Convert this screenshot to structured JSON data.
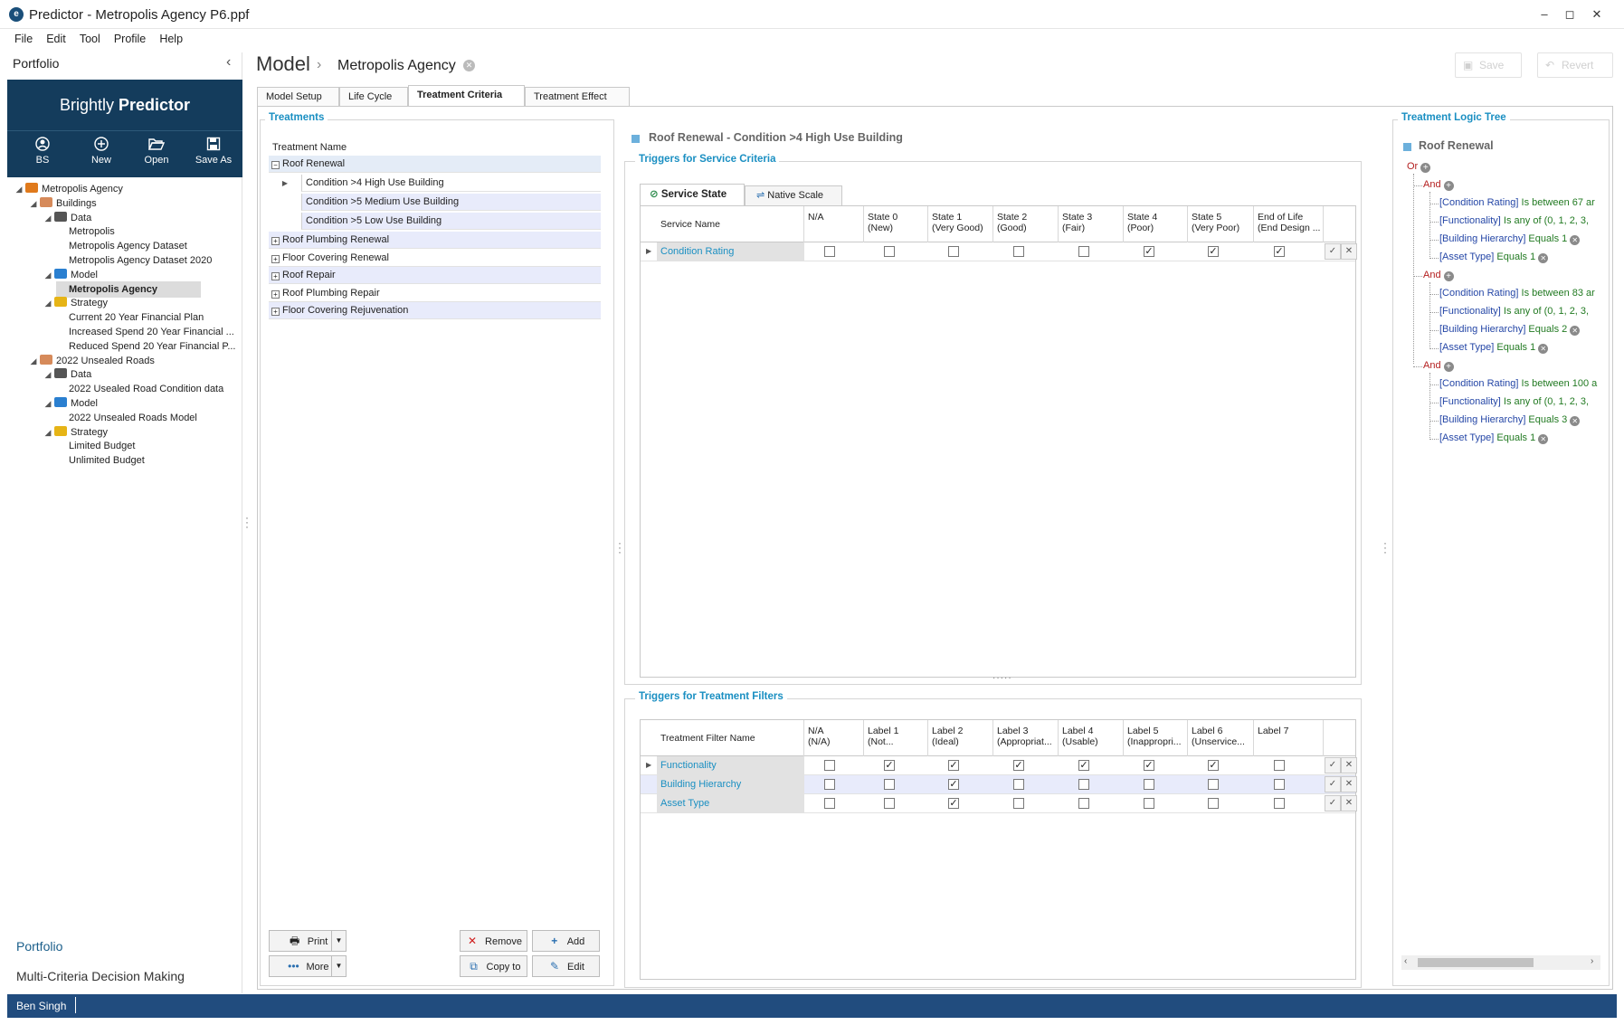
{
  "window": {
    "title": "Predictor - Metropolis Agency P6.ppf",
    "minimize": "–",
    "maximize": "◻",
    "close": "✕"
  },
  "menu": [
    "File",
    "Edit",
    "Tool",
    "Profile",
    "Help"
  ],
  "left_panel": {
    "title": "Portfolio",
    "brand_light": "Brightly ",
    "brand_bold": "Predictor",
    "toolbar": [
      {
        "label": "BS",
        "icon": "user-icon"
      },
      {
        "label": "New",
        "icon": "plus-circle-icon"
      },
      {
        "label": "Open",
        "icon": "folder-open-icon"
      },
      {
        "label": "Save As",
        "icon": "save-icon"
      }
    ],
    "tree": [
      {
        "label": "Metropolis Agency",
        "icon": "portfolio-icon",
        "level": 0,
        "expander": true,
        "selected": false
      },
      {
        "label": "Buildings",
        "icon": "asset-group-icon",
        "level": 1,
        "expander": true,
        "selected": false
      },
      {
        "label": "Data",
        "icon": "database-icon",
        "level": 2,
        "expander": true,
        "selected": false
      },
      {
        "label": "Metropolis",
        "icon": "",
        "level": 3,
        "expander": false,
        "selected": false
      },
      {
        "label": "Metropolis Agency Dataset",
        "icon": "",
        "level": 3,
        "expander": false,
        "selected": false
      },
      {
        "label": "Metropolis Agency Dataset 2020",
        "icon": "",
        "level": 3,
        "expander": false,
        "selected": false
      },
      {
        "label": "Model",
        "icon": "chart-icon",
        "level": 2,
        "expander": true,
        "selected": false
      },
      {
        "label": "Metropolis Agency",
        "icon": "",
        "level": 3,
        "expander": false,
        "selected": true
      },
      {
        "label": "Strategy",
        "icon": "coins-icon",
        "level": 2,
        "expander": true,
        "selected": false
      },
      {
        "label": "Current 20 Year Financial Plan",
        "icon": "",
        "level": 3,
        "expander": false,
        "selected": false
      },
      {
        "label": "Increased Spend 20 Year Financial ...",
        "icon": "",
        "level": 3,
        "expander": false,
        "selected": false
      },
      {
        "label": "Reduced Spend 20 Year Financial P...",
        "icon": "",
        "level": 3,
        "expander": false,
        "selected": false
      },
      {
        "label": "2022 Unsealed Roads",
        "icon": "asset-group-icon",
        "level": 1,
        "expander": true,
        "selected": false
      },
      {
        "label": "Data",
        "icon": "database-icon",
        "level": 2,
        "expander": true,
        "selected": false
      },
      {
        "label": "2022 Usealed Road Condition data",
        "icon": "",
        "level": 3,
        "expander": false,
        "selected": false
      },
      {
        "label": "Model",
        "icon": "chart-icon",
        "level": 2,
        "expander": true,
        "selected": false
      },
      {
        "label": "2022 Unsealed Roads Model",
        "icon": "",
        "level": 3,
        "expander": false,
        "selected": false
      },
      {
        "label": "Strategy",
        "icon": "coins-icon",
        "level": 2,
        "expander": true,
        "selected": false
      },
      {
        "label": "Limited Budget",
        "icon": "",
        "level": 3,
        "expander": false,
        "selected": false
      },
      {
        "label": "Unlimited Budget",
        "icon": "",
        "level": 3,
        "expander": false,
        "selected": false
      }
    ],
    "bottom_links": [
      "Portfolio",
      "Multi-Criteria Decision Making"
    ]
  },
  "status_bar": {
    "user": "Ben Singh"
  },
  "header": {
    "section": "Model",
    "chevron": "›",
    "model_name": "Metropolis Agency",
    "save_label": "Save",
    "revert_label": "Revert"
  },
  "tabs": [
    {
      "label": "Model Setup",
      "active": false
    },
    {
      "label": "Life Cycle",
      "active": false
    },
    {
      "label": "Treatment Criteria",
      "active": true
    },
    {
      "label": "Treatment Effect",
      "active": false
    }
  ],
  "treatments": {
    "title": "Treatments",
    "column_header": "Treatment Name",
    "rows": [
      {
        "label": "Roof Renewal",
        "type": "group",
        "expanded": true
      },
      {
        "label": "Condition >4 High Use Building",
        "type": "child",
        "current": true
      },
      {
        "label": "Condition >5 Medium Use Building",
        "type": "child",
        "current": false
      },
      {
        "label": "Condition >5 Low Use Building",
        "type": "child",
        "current": false
      },
      {
        "label": "Roof Plumbing Renewal",
        "type": "group",
        "expanded": false
      },
      {
        "label": "Floor Covering Renewal",
        "type": "group",
        "expanded": false
      },
      {
        "label": "Roof Repair",
        "type": "group",
        "expanded": false
      },
      {
        "label": "Roof Plumbing Repair",
        "type": "group",
        "expanded": false
      },
      {
        "label": "Floor Covering Rejuvenation",
        "type": "group",
        "expanded": false
      }
    ],
    "buttons": {
      "print": "Print",
      "more": "More",
      "remove": "Remove",
      "copy_to": "Copy to",
      "add": "Add",
      "edit": "Edit"
    }
  },
  "criteria": {
    "selected_title": "Roof Renewal - Condition >4 High Use Building",
    "service": {
      "title": "Triggers for Service Criteria",
      "subtabs": [
        {
          "label": "Service State",
          "active": true
        },
        {
          "label": "Native Scale",
          "active": false
        }
      ],
      "columns": [
        {
          "l1": "Service Name",
          "l2": ""
        },
        {
          "l1": "N/A",
          "l2": ""
        },
        {
          "l1": "State 0",
          "l2": "(New)"
        },
        {
          "l1": "State 1",
          "l2": "(Very Good)"
        },
        {
          "l1": "State 2",
          "l2": "(Good)"
        },
        {
          "l1": "State 3",
          "l2": "(Fair)"
        },
        {
          "l1": "State 4",
          "l2": "(Poor)"
        },
        {
          "l1": "State 5",
          "l2": "(Very Poor)"
        },
        {
          "l1": "End of Life",
          "l2": "(End Design ..."
        }
      ],
      "rows": [
        {
          "name": "Condition Rating",
          "checks": [
            false,
            false,
            false,
            false,
            false,
            true,
            true,
            true
          ]
        }
      ]
    },
    "filters": {
      "title": "Triggers for Treatment Filters",
      "columns": [
        {
          "l1": "Treatment Filter Name",
          "l2": ""
        },
        {
          "l1": "N/A",
          "l2": "(N/A)"
        },
        {
          "l1": "Label 1",
          "l2": "(Not..."
        },
        {
          "l1": "Label 2",
          "l2": "(Ideal)"
        },
        {
          "l1": "Label 3",
          "l2": "(Appropriat..."
        },
        {
          "l1": "Label 4",
          "l2": "(Usable)"
        },
        {
          "l1": "Label 5",
          "l2": "(Inappropri..."
        },
        {
          "l1": "Label 6",
          "l2": "(Unservice..."
        },
        {
          "l1": "Label 7",
          "l2": ""
        }
      ],
      "rows": [
        {
          "name": "Functionality",
          "checks": [
            false,
            true,
            true,
            true,
            true,
            true,
            true,
            false
          ]
        },
        {
          "name": "Building Hierarchy",
          "checks": [
            false,
            false,
            true,
            false,
            false,
            false,
            false,
            false
          ]
        },
        {
          "name": "Asset Type",
          "checks": [
            false,
            false,
            true,
            false,
            false,
            false,
            false,
            false
          ]
        }
      ]
    },
    "confirm_glyph": "✓",
    "clear_glyph": "✕"
  },
  "logic_tree": {
    "title": "Treatment Logic Tree",
    "root_label": "Roof Renewal",
    "or_label": "Or",
    "groups": [
      {
        "label": "And",
        "conditions": [
          {
            "field": "[Condition Rating]",
            "op": " Is between 67 ar"
          },
          {
            "field": "[Functionality]",
            "op": " Is any of (0, 1, 2, 3,"
          },
          {
            "field": "[Building Hierarchy]",
            "op": " Equals 1"
          },
          {
            "field": "[Asset Type]",
            "op": " Equals 1"
          }
        ]
      },
      {
        "label": "And",
        "conditions": [
          {
            "field": "[Condition Rating]",
            "op": " Is between 83 ar"
          },
          {
            "field": "[Functionality]",
            "op": " Is any of (0, 1, 2, 3,"
          },
          {
            "field": "[Building Hierarchy]",
            "op": " Equals 2"
          },
          {
            "field": "[Asset Type]",
            "op": " Equals 1"
          }
        ]
      },
      {
        "label": "And",
        "conditions": [
          {
            "field": "[Condition Rating]",
            "op": " Is between 100 a"
          },
          {
            "field": "[Functionality]",
            "op": " Is any of (0, 1, 2, 3,"
          },
          {
            "field": "[Building Hierarchy]",
            "op": " Equals 3"
          },
          {
            "field": "[Asset Type]",
            "op": " Equals 1"
          }
        ]
      }
    ]
  },
  "colors": {
    "brand_bg": "#143c5c",
    "status_bg": "#214c7e",
    "section_title": "#1a8fc2",
    "link_blue": "#2446a6",
    "value_green": "#227a22",
    "operator_red": "#b42020"
  }
}
